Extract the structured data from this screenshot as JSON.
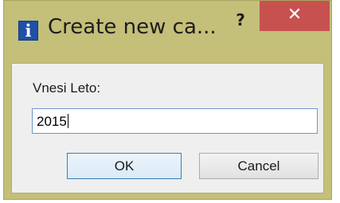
{
  "window": {
    "title": "Create new ca...",
    "icon": "info-icon",
    "icon_glyph": "i",
    "help_glyph": "?",
    "close_glyph": "✕",
    "frame_color": "#c4bf79",
    "close_color": "#c7514f"
  },
  "form": {
    "label": "Vnesi Leto:",
    "value": "2015"
  },
  "buttons": {
    "ok": "OK",
    "cancel": "Cancel"
  }
}
